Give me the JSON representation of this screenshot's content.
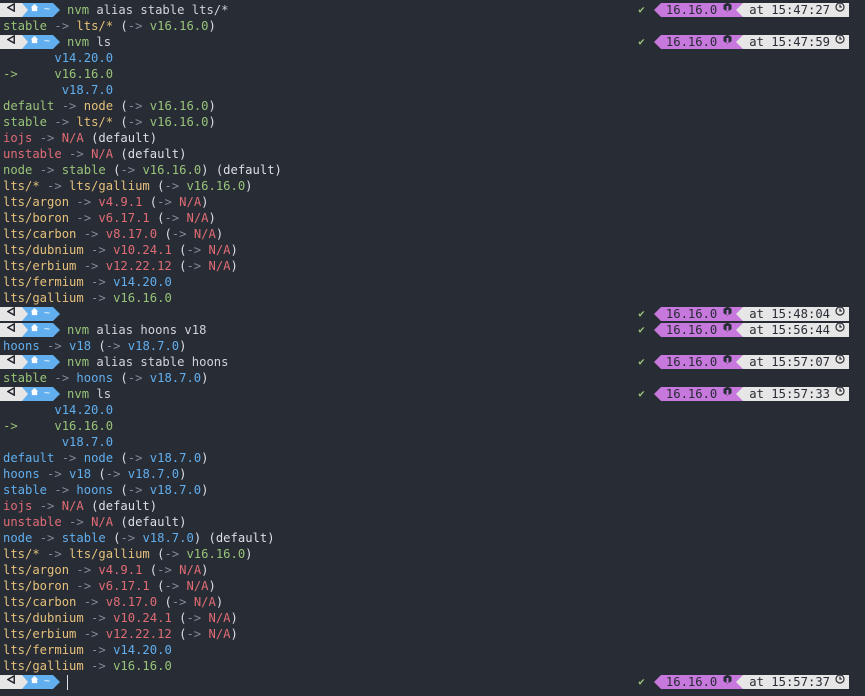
{
  "prompt": {
    "os_icon": "apple-logo-icon",
    "home_icon": "home-icon",
    "dir": "~",
    "status_check": "✔",
    "node_icon": "nodejs-icon",
    "clock_icon": "clock-icon"
  },
  "lines": [
    {
      "type": "prompt",
      "cmd": "nvm alias stable lts/*",
      "version": "16.16.0",
      "time": "at 15:47:27"
    },
    {
      "type": "out",
      "parts": [
        [
          "stable",
          "g"
        ],
        [
          " -> ",
          "d"
        ],
        [
          "lts/*",
          "y"
        ],
        [
          " (",
          "w"
        ],
        [
          "-> ",
          "d"
        ],
        [
          "v16.16.0",
          "g"
        ],
        [
          ")",
          "w"
        ]
      ]
    },
    {
      "type": "prompt",
      "cmd": "nvm ls",
      "version": "16.16.0",
      "time": "at 15:47:59"
    },
    {
      "type": "out",
      "parts": [
        [
          "       v14.20.0",
          "b"
        ]
      ]
    },
    {
      "type": "out",
      "parts": [
        [
          "->     ",
          "g"
        ],
        [
          "v16.16.0",
          "g"
        ]
      ]
    },
    {
      "type": "out",
      "parts": [
        [
          "        v18.7.0",
          "b"
        ]
      ]
    },
    {
      "type": "out",
      "parts": [
        [
          "default",
          "g"
        ],
        [
          " -> ",
          "d"
        ],
        [
          "node",
          "y"
        ],
        [
          " (",
          "w"
        ],
        [
          "-> ",
          "d"
        ],
        [
          "v16.16.0",
          "g"
        ],
        [
          ")",
          "w"
        ]
      ]
    },
    {
      "type": "out",
      "parts": [
        [
          "stable",
          "g"
        ],
        [
          " -> ",
          "d"
        ],
        [
          "lts/*",
          "y"
        ],
        [
          " (",
          "w"
        ],
        [
          "-> ",
          "d"
        ],
        [
          "v16.16.0",
          "g"
        ],
        [
          ")",
          "w"
        ]
      ]
    },
    {
      "type": "out",
      "parts": [
        [
          "iojs",
          "r"
        ],
        [
          " -> ",
          "d"
        ],
        [
          "N/A",
          "r"
        ],
        [
          " (default)",
          "w"
        ]
      ]
    },
    {
      "type": "out",
      "parts": [
        [
          "unstable",
          "r"
        ],
        [
          " -> ",
          "d"
        ],
        [
          "N/A",
          "r"
        ],
        [
          " (default)",
          "w"
        ]
      ]
    },
    {
      "type": "out",
      "parts": [
        [
          "node",
          "g"
        ],
        [
          " -> ",
          "d"
        ],
        [
          "stable",
          "g"
        ],
        [
          " (",
          "w"
        ],
        [
          "-> ",
          "d"
        ],
        [
          "v16.16.0",
          "g"
        ],
        [
          ") (default)",
          "w"
        ]
      ]
    },
    {
      "type": "out",
      "parts": [
        [
          "lts/*",
          "y"
        ],
        [
          " -> ",
          "d"
        ],
        [
          "lts/gallium",
          "y"
        ],
        [
          " (",
          "w"
        ],
        [
          "-> ",
          "d"
        ],
        [
          "v16.16.0",
          "g"
        ],
        [
          ")",
          "w"
        ]
      ]
    },
    {
      "type": "out",
      "parts": [
        [
          "lts/argon",
          "y"
        ],
        [
          " -> ",
          "d"
        ],
        [
          "v4.9.1",
          "r"
        ],
        [
          " (",
          "w"
        ],
        [
          "-> ",
          "d"
        ],
        [
          "N/A",
          "r"
        ],
        [
          ")",
          "w"
        ]
      ]
    },
    {
      "type": "out",
      "parts": [
        [
          "lts/boron",
          "y"
        ],
        [
          " -> ",
          "d"
        ],
        [
          "v6.17.1",
          "r"
        ],
        [
          " (",
          "w"
        ],
        [
          "-> ",
          "d"
        ],
        [
          "N/A",
          "r"
        ],
        [
          ")",
          "w"
        ]
      ]
    },
    {
      "type": "out",
      "parts": [
        [
          "lts/carbon",
          "y"
        ],
        [
          " -> ",
          "d"
        ],
        [
          "v8.17.0",
          "r"
        ],
        [
          " (",
          "w"
        ],
        [
          "-> ",
          "d"
        ],
        [
          "N/A",
          "r"
        ],
        [
          ")",
          "w"
        ]
      ]
    },
    {
      "type": "out",
      "parts": [
        [
          "lts/dubnium",
          "y"
        ],
        [
          " -> ",
          "d"
        ],
        [
          "v10.24.1",
          "r"
        ],
        [
          " (",
          "w"
        ],
        [
          "-> ",
          "d"
        ],
        [
          "N/A",
          "r"
        ],
        [
          ")",
          "w"
        ]
      ]
    },
    {
      "type": "out",
      "parts": [
        [
          "lts/erbium",
          "y"
        ],
        [
          " -> ",
          "d"
        ],
        [
          "v12.22.12",
          "r"
        ],
        [
          " (",
          "w"
        ],
        [
          "-> ",
          "d"
        ],
        [
          "N/A",
          "r"
        ],
        [
          ")",
          "w"
        ]
      ]
    },
    {
      "type": "out",
      "parts": [
        [
          "lts/fermium",
          "y"
        ],
        [
          " -> ",
          "d"
        ],
        [
          "v14.20.0",
          "b"
        ]
      ]
    },
    {
      "type": "out",
      "parts": [
        [
          "lts/gallium",
          "y"
        ],
        [
          " -> ",
          "d"
        ],
        [
          "v16.16.0",
          "g"
        ]
      ]
    },
    {
      "type": "prompt",
      "cmd": "",
      "version": "16.16.0",
      "time": "at 15:48:04"
    },
    {
      "type": "prompt",
      "cmd": "nvm alias hoons v18",
      "version": "16.16.0",
      "time": "at 15:56:44"
    },
    {
      "type": "out",
      "parts": [
        [
          "hoons",
          "b"
        ],
        [
          " -> ",
          "d"
        ],
        [
          "v18",
          "b"
        ],
        [
          " (",
          "w"
        ],
        [
          "-> ",
          "d"
        ],
        [
          "v18.7.0",
          "b"
        ],
        [
          ")",
          "w"
        ]
      ]
    },
    {
      "type": "prompt",
      "cmd": "nvm alias stable hoons",
      "version": "16.16.0",
      "time": "at 15:57:07"
    },
    {
      "type": "out",
      "parts": [
        [
          "stable",
          "g"
        ],
        [
          " -> ",
          "d"
        ],
        [
          "hoons",
          "b"
        ],
        [
          " (",
          "w"
        ],
        [
          "-> ",
          "d"
        ],
        [
          "v18.7.0",
          "b"
        ],
        [
          ")",
          "w"
        ]
      ]
    },
    {
      "type": "prompt",
      "cmd": "nvm ls",
      "version": "16.16.0",
      "time": "at 15:57:33"
    },
    {
      "type": "out",
      "parts": [
        [
          "       v14.20.0",
          "b"
        ]
      ]
    },
    {
      "type": "out",
      "parts": [
        [
          "->     ",
          "g"
        ],
        [
          "v16.16.0",
          "g"
        ]
      ]
    },
    {
      "type": "out",
      "parts": [
        [
          "        v18.7.0",
          "b"
        ]
      ]
    },
    {
      "type": "out",
      "parts": [
        [
          "default",
          "b"
        ],
        [
          " -> ",
          "d"
        ],
        [
          "node",
          "b"
        ],
        [
          " (",
          "w"
        ],
        [
          "-> ",
          "d"
        ],
        [
          "v18.7.0",
          "b"
        ],
        [
          ")",
          "w"
        ]
      ]
    },
    {
      "type": "out",
      "parts": [
        [
          "hoons",
          "b"
        ],
        [
          " -> ",
          "d"
        ],
        [
          "v18",
          "b"
        ],
        [
          " (",
          "w"
        ],
        [
          "-> ",
          "d"
        ],
        [
          "v18.7.0",
          "b"
        ],
        [
          ")",
          "w"
        ]
      ]
    },
    {
      "type": "out",
      "parts": [
        [
          "stable",
          "b"
        ],
        [
          " -> ",
          "d"
        ],
        [
          "hoons",
          "b"
        ],
        [
          " (",
          "w"
        ],
        [
          "-> ",
          "d"
        ],
        [
          "v18.7.0",
          "b"
        ],
        [
          ")",
          "w"
        ]
      ]
    },
    {
      "type": "out",
      "parts": [
        [
          "iojs",
          "r"
        ],
        [
          " -> ",
          "d"
        ],
        [
          "N/A",
          "r"
        ],
        [
          " (default)",
          "w"
        ]
      ]
    },
    {
      "type": "out",
      "parts": [
        [
          "unstable",
          "r"
        ],
        [
          " -> ",
          "d"
        ],
        [
          "N/A",
          "r"
        ],
        [
          " (default)",
          "w"
        ]
      ]
    },
    {
      "type": "out",
      "parts": [
        [
          "node",
          "b"
        ],
        [
          " -> ",
          "d"
        ],
        [
          "stable",
          "b"
        ],
        [
          " (",
          "w"
        ],
        [
          "-> ",
          "d"
        ],
        [
          "v18.7.0",
          "b"
        ],
        [
          ") (default)",
          "w"
        ]
      ]
    },
    {
      "type": "out",
      "parts": [
        [
          "lts/*",
          "y"
        ],
        [
          " -> ",
          "d"
        ],
        [
          "lts/gallium",
          "y"
        ],
        [
          " (",
          "w"
        ],
        [
          "-> ",
          "d"
        ],
        [
          "v16.16.0",
          "g"
        ],
        [
          ")",
          "w"
        ]
      ]
    },
    {
      "type": "out",
      "parts": [
        [
          "lts/argon",
          "y"
        ],
        [
          " -> ",
          "d"
        ],
        [
          "v4.9.1",
          "r"
        ],
        [
          " (",
          "w"
        ],
        [
          "-> ",
          "d"
        ],
        [
          "N/A",
          "r"
        ],
        [
          ")",
          "w"
        ]
      ]
    },
    {
      "type": "out",
      "parts": [
        [
          "lts/boron",
          "y"
        ],
        [
          " -> ",
          "d"
        ],
        [
          "v6.17.1",
          "r"
        ],
        [
          " (",
          "w"
        ],
        [
          "-> ",
          "d"
        ],
        [
          "N/A",
          "r"
        ],
        [
          ")",
          "w"
        ]
      ]
    },
    {
      "type": "out",
      "parts": [
        [
          "lts/carbon",
          "y"
        ],
        [
          " -> ",
          "d"
        ],
        [
          "v8.17.0",
          "r"
        ],
        [
          " (",
          "w"
        ],
        [
          "-> ",
          "d"
        ],
        [
          "N/A",
          "r"
        ],
        [
          ")",
          "w"
        ]
      ]
    },
    {
      "type": "out",
      "parts": [
        [
          "lts/dubnium",
          "y"
        ],
        [
          " -> ",
          "d"
        ],
        [
          "v10.24.1",
          "r"
        ],
        [
          " (",
          "w"
        ],
        [
          "-> ",
          "d"
        ],
        [
          "N/A",
          "r"
        ],
        [
          ")",
          "w"
        ]
      ]
    },
    {
      "type": "out",
      "parts": [
        [
          "lts/erbium",
          "y"
        ],
        [
          " -> ",
          "d"
        ],
        [
          "v12.22.12",
          "r"
        ],
        [
          " (",
          "w"
        ],
        [
          "-> ",
          "d"
        ],
        [
          "N/A",
          "r"
        ],
        [
          ")",
          "w"
        ]
      ]
    },
    {
      "type": "out",
      "parts": [
        [
          "lts/fermium",
          "y"
        ],
        [
          " -> ",
          "d"
        ],
        [
          "v14.20.0",
          "b"
        ]
      ]
    },
    {
      "type": "out",
      "parts": [
        [
          "lts/gallium",
          "y"
        ],
        [
          " -> ",
          "d"
        ],
        [
          "v16.16.0",
          "g"
        ]
      ]
    },
    {
      "type": "prompt",
      "cmd": "",
      "version": "16.16.0",
      "time": "at 15:57:37",
      "cursor": true
    }
  ]
}
